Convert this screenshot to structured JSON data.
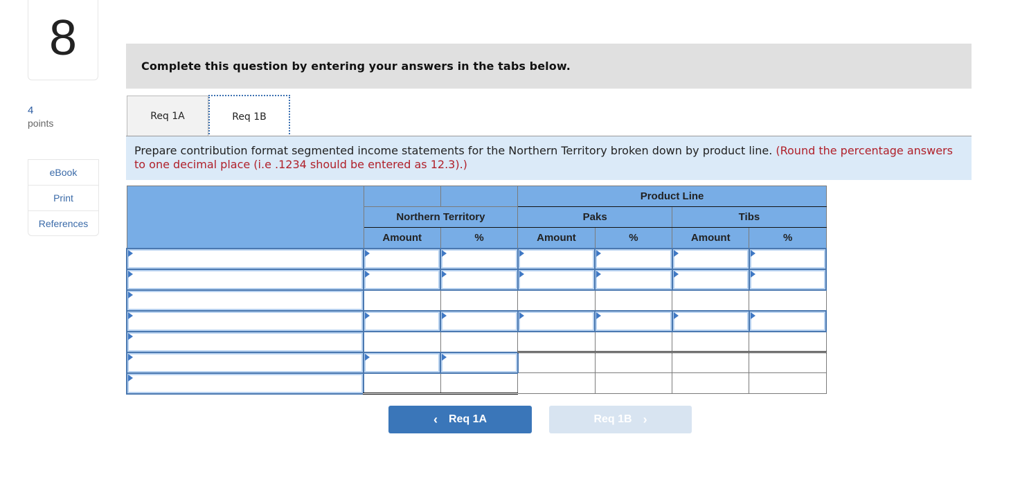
{
  "question": {
    "number": "8",
    "points_value": "4",
    "points_label": "points"
  },
  "side_links": [
    {
      "label": "eBook"
    },
    {
      "label": "Print"
    },
    {
      "label": "References"
    }
  ],
  "banner": {
    "text": "Complete this question by entering your answers in the tabs below."
  },
  "tabs": [
    {
      "label": "Req 1A",
      "active": false
    },
    {
      "label": "Req 1B",
      "active": true
    }
  ],
  "instructions": {
    "text": "Prepare contribution format segmented income statements for the Northern Territory broken down by product line.",
    "note": "(Round the percentage answers to one decimal place (i.e .1234 should be entered as 12.3).)"
  },
  "table": {
    "group_header": "Product Line",
    "segments": [
      "Northern Territory",
      "Paks",
      "Tibs"
    ],
    "columns": [
      "Amount",
      "%",
      "Amount",
      "%",
      "Amount",
      "%"
    ],
    "rows": [
      {
        "label": "",
        "values": [
          "",
          "",
          "",
          "",
          "",
          ""
        ]
      },
      {
        "label": "",
        "values": [
          "",
          "",
          "",
          "",
          "",
          ""
        ]
      },
      {
        "label": "",
        "values": [
          "",
          "",
          "",
          "",
          "",
          ""
        ]
      },
      {
        "label": "",
        "values": [
          "",
          "",
          "",
          "",
          "",
          ""
        ]
      },
      {
        "label": "",
        "values": [
          "",
          "",
          "",
          "",
          "",
          ""
        ]
      },
      {
        "label": "",
        "values": [
          "",
          "",
          "",
          "",
          "",
          ""
        ]
      },
      {
        "label": "",
        "values": [
          "",
          "",
          "",
          "",
          "",
          ""
        ]
      }
    ]
  },
  "nav": {
    "prev_label": "Req 1A",
    "next_label": "Req 1B",
    "prev_icon": "chevron-left-icon",
    "next_icon": "chevron-right-icon"
  },
  "colors": {
    "header_blue": "#78ade6",
    "input_border": "#4a78b0",
    "prev_button": "#3a76b9",
    "next_button_disabled": "#d8e4f1",
    "instruction_bg": "#dbeaf8",
    "note_red": "#b0202a"
  }
}
